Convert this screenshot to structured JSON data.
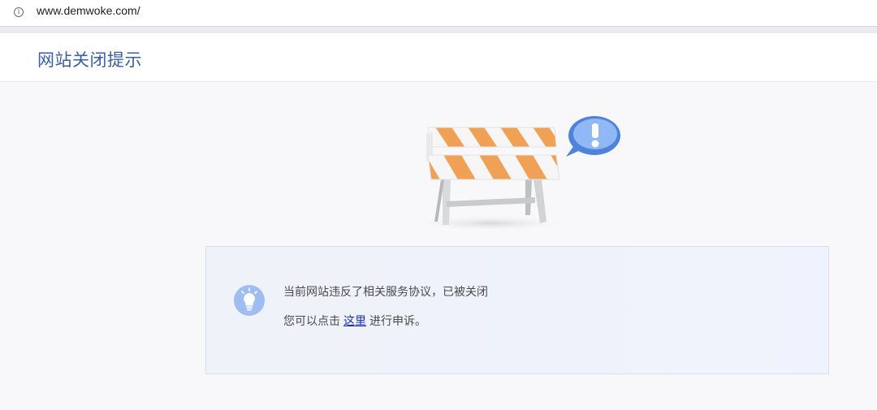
{
  "browser": {
    "url": "www.demwoke.com/",
    "info_icon": "info-circle-icon"
  },
  "header": {
    "title": "网站关闭提示"
  },
  "illustration": {
    "icon": "road-barrier-with-exclamation-bubble",
    "colors": {
      "stripe_orange": "#f0a156",
      "stripe_white": "#ffffff",
      "bubble_blue": "#4d84d9"
    }
  },
  "notice": {
    "icon": "lightbulb-icon",
    "line1": "当前网站违反了相关服务协议，已被关闭",
    "line2_prefix": "您可以点击",
    "link_text": "这里",
    "line2_suffix": "进行申诉。"
  },
  "colors": {
    "title": "#3d5f9e",
    "link": "#1a2fb0",
    "background": "#f8f8fa"
  }
}
